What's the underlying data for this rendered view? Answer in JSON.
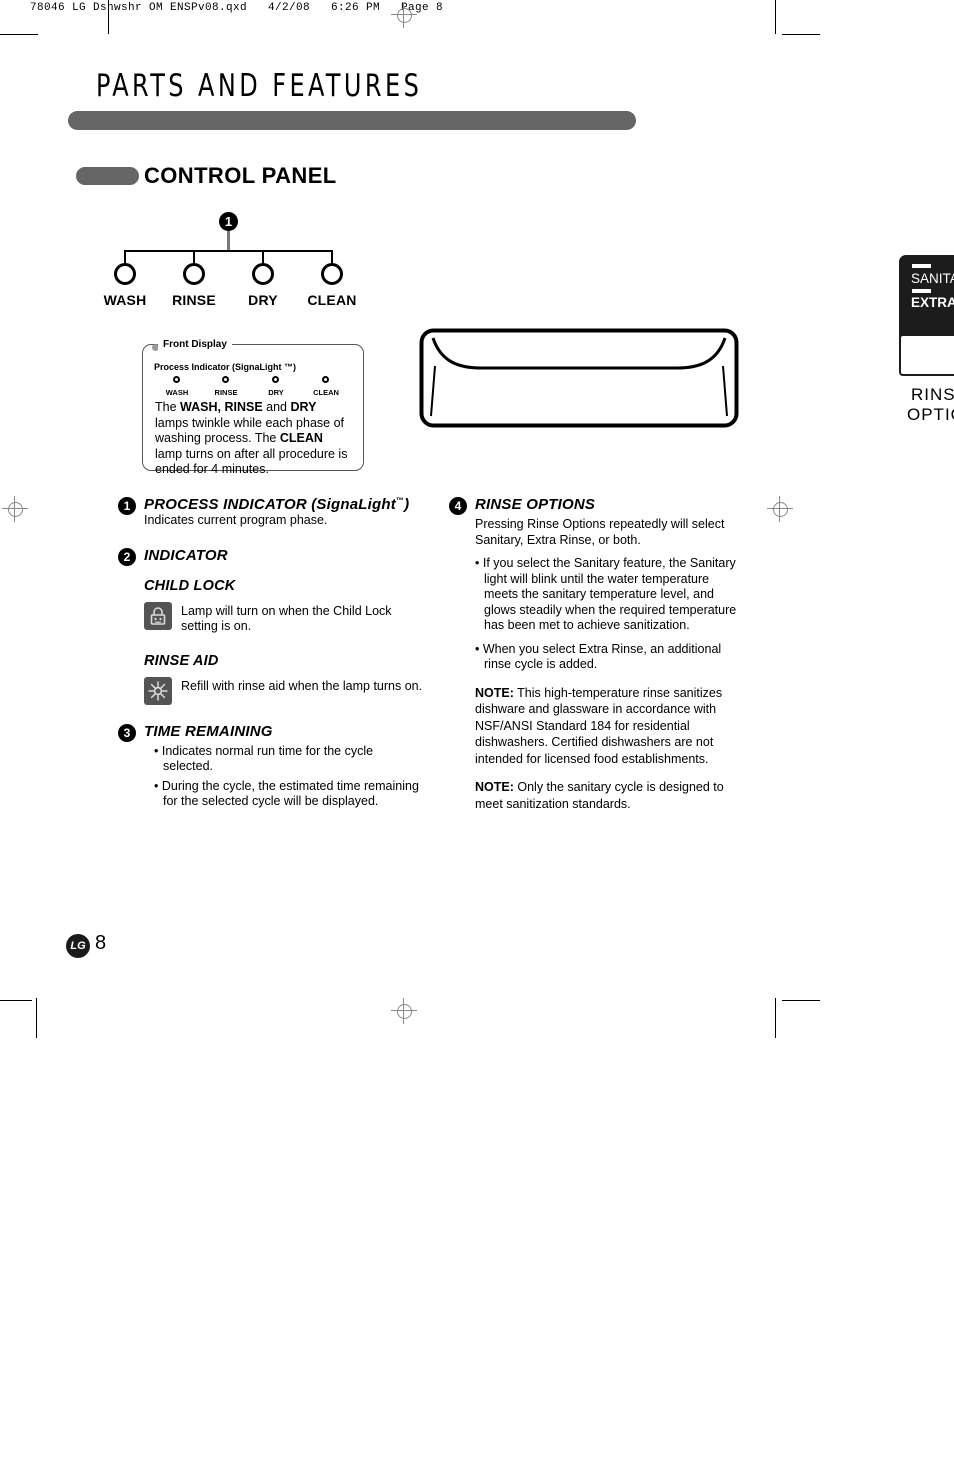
{
  "print_header": "78046 LG Dshwshr OM ENSPv08.qxd   4/2/08   6:26 PM   Page 8",
  "chapter": {
    "title": "PARTS AND FEATURES"
  },
  "section": {
    "title": "CONTROL PANEL"
  },
  "diagram": {
    "callout_number": "1",
    "lamps": [
      {
        "label": "WASH"
      },
      {
        "label": "RINSE"
      },
      {
        "label": "DRY"
      },
      {
        "label": "CLEAN"
      }
    ]
  },
  "front_display": {
    "legend": "Front Display",
    "subtitle": "Process Indicator (SignaLight ™)",
    "lamps": [
      {
        "label": "WASH"
      },
      {
        "label": "RINSE"
      },
      {
        "label": "DRY"
      },
      {
        "label": "CLEAN"
      }
    ],
    "body_lead": "The ",
    "body_b1": "WASH, RINSE",
    "body_mid1": " and ",
    "body_b2": "DRY",
    "body_mid2": " lamps twinkle while each phase of washing process. The ",
    "body_b3": "CLEAN",
    "body_tail": " lamp turns on after all procedure is ended for 4 minutes."
  },
  "edge_panel": {
    "label_sanitary": "SANITA",
    "label_extra_rinse": "EXTRA RI",
    "caption_line1": "RINS",
    "caption_line2": "OPTIO"
  },
  "entries": {
    "item1": {
      "num": "1",
      "heading": "PROCESS INDICATOR (SignaLight",
      "heading_tm": "™",
      "heading_close": ")",
      "body": "Indicates current program phase."
    },
    "item2": {
      "num": "2",
      "heading": "INDICATOR",
      "child_lock": {
        "heading": "CHILD LOCK",
        "icon": "padlock-icon",
        "text": "Lamp will turn on when the Child Lock setting is on."
      },
      "rinse_aid": {
        "heading": "RINSE AID",
        "icon": "starburst-icon",
        "text": "Refill with rinse aid when the lamp turns on."
      }
    },
    "item3": {
      "num": "3",
      "heading": "TIME REMAINING",
      "bullets": [
        "• Indicates normal run time for the cycle selected.",
        "• During the cycle, the estimated time remaining for the selected cycle will be displayed."
      ]
    },
    "item4": {
      "num": "4",
      "heading": "RINSE OPTIONS",
      "body": "Pressing Rinse Options repeatedly will select Sanitary, Extra Rinse, or both.",
      "bullets": [
        "• If you select the Sanitary feature, the Sanitary light will blink until the water temperature meets the sanitary temperature level, and glows steadily when the required temperature has been met to achieve sanitization.",
        "• When you select Extra Rinse, an additional rinse cycle is added."
      ],
      "note1_label": "NOTE:",
      "note1_text": " This high-temperature rinse sanitizes dishware and glassware in accordance with NSF/ANSI Standard 184 for residential dishwashers. Certified dishwashers are not intended for licensed food establishments.",
      "note2_label": "NOTE:",
      "note2_text": " Only the sanitary cycle is designed to meet sanitization standards."
    }
  },
  "footer": {
    "brand": "LG",
    "page_number": "8"
  },
  "colors": {
    "gray_bar": "#666666",
    "icon_box": "#545454",
    "panel_black": "#1c1c1c"
  }
}
